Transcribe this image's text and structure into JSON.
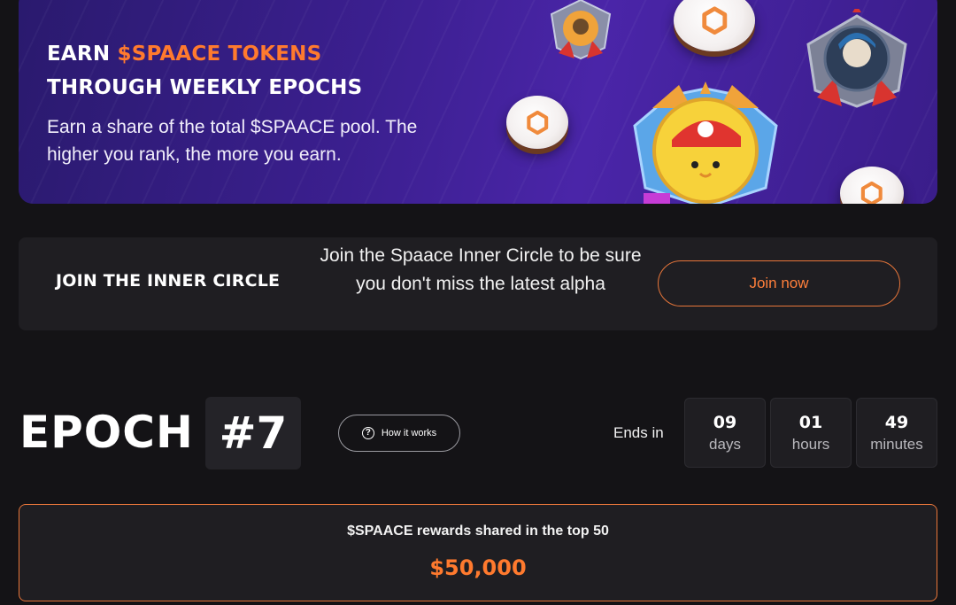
{
  "hero": {
    "title_prefix": "EARN ",
    "title_accent": "$SPAACE TOKENS",
    "title_line2": "THROUGH WEEKLY EPOCHS",
    "description": "Earn a share of the total $SPAACE pool. The higher you rank, the more you earn."
  },
  "join": {
    "title": "JOIN THE INNER CIRCLE",
    "text": "Join the Spaace Inner Circle to be sure you don't miss the latest alpha",
    "button": "Join now"
  },
  "epoch": {
    "label": "EPOCH",
    "number": "#7",
    "how_it_works": "How it works",
    "ends_in": "Ends in",
    "timer": [
      {
        "value": "09",
        "unit": "days"
      },
      {
        "value": "01",
        "unit": "hours"
      },
      {
        "value": "49",
        "unit": "minutes"
      }
    ]
  },
  "rewards": {
    "label": "$SPAACE rewards shared in the top 50",
    "amount": "$50,000"
  },
  "colors": {
    "accent": "#ff7a2e",
    "background": "#141316",
    "card": "#1f1e22",
    "hero_purple": "#3b1f8f"
  },
  "icons": {
    "question": "question-circle-icon",
    "coin": "spaace-coin-icon",
    "medal": "medal-badge-icon"
  }
}
